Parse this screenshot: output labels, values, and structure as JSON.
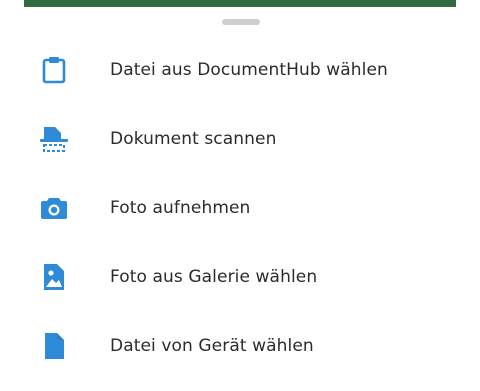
{
  "colors": {
    "accent": "#2f8ad8",
    "backdrop_strip": "#2f6b3f",
    "text": "#2b2b2b",
    "handle": "#cfcfcf"
  },
  "sheet": {
    "items": [
      {
        "icon": "clipboard-icon",
        "label": "Datei aus DocumentHub wählen"
      },
      {
        "icon": "scanner-icon",
        "label": "Dokument scannen"
      },
      {
        "icon": "camera-icon",
        "label": "Foto aufnehmen"
      },
      {
        "icon": "image-file-icon",
        "label": "Foto aus Galerie wählen"
      },
      {
        "icon": "file-icon",
        "label": "Datei von Gerät wählen"
      }
    ]
  }
}
